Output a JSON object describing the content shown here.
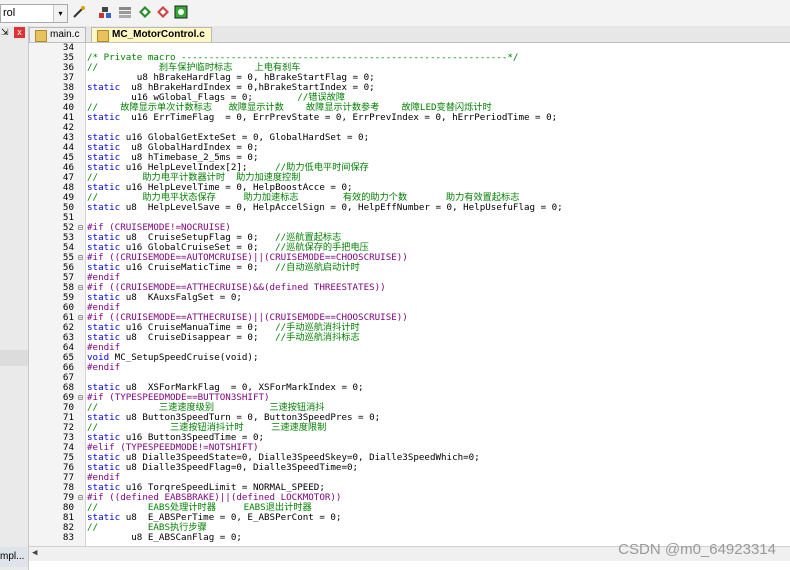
{
  "toolbar": {
    "combo_text": "rol",
    "combo_arrow": "▾",
    "icons": [
      "wand-icon",
      "build-icon",
      "rebuild-icon",
      "download-icon",
      "translate-icon"
    ]
  },
  "sidebar": {
    "close_label": "x",
    "bottom_label": "mpl..."
  },
  "tabs": [
    {
      "label": "main.c",
      "active": false
    },
    {
      "label": "MC_MotorControl.c",
      "active": true
    }
  ],
  "watermark": "CSDN @m0_64923314",
  "code": [
    {
      "n": "34",
      "t": "",
      "cls": "n"
    },
    {
      "n": "35",
      "t": "/* Private macro -----------------------------------------------------------*/",
      "cls": "c"
    },
    {
      "n": "36",
      "t": "//           刹车保护临时标志    上电有刹车",
      "cls": "c"
    },
    {
      "n": "37",
      "t": "         u8 hBrakeHardFlag = 0, hBrakeStartFlag = 0;",
      "cls": "n"
    },
    {
      "n": "38",
      "t": "static  u8 hBrakeHardIndex = 0,hBrakeStartIndex = 0;",
      "cls": "n"
    },
    {
      "n": "39",
      "t": "        u16 wGlobal_Flags = 0;        //错误故障",
      "cls": "n"
    },
    {
      "n": "40",
      "t": "//    故障显示单次计数标志   故障显示计数    故障显示计数参考    故障LED变替闪烁计时",
      "cls": "c"
    },
    {
      "n": "41",
      "t": "static  u16 ErrTimeFlag  = 0, ErrPrevState = 0, ErrPrevIndex = 0, hErrPeriodTime = 0;",
      "cls": "n"
    },
    {
      "n": "42",
      "t": "",
      "cls": "n"
    },
    {
      "n": "43",
      "t": "static u16 GlobalGetExteSet = 0, GlobalHardSet = 0;",
      "cls": "n"
    },
    {
      "n": "44",
      "t": "static  u8 GlobalHardIndex = 0;",
      "cls": "n"
    },
    {
      "n": "45",
      "t": "static  u8 hTimebase_2_5ms = 0;",
      "cls": "n"
    },
    {
      "n": "46",
      "t": "static u16 HelpLevelIndex[2];     //助力低电平时间保存",
      "cls": "n"
    },
    {
      "n": "47",
      "t": "//        助力电平计数器计时  助力加速度控制",
      "cls": "c"
    },
    {
      "n": "48",
      "t": "static u16 HelpLevelTime = 0, HelpBoostAcce = 0;",
      "cls": "n"
    },
    {
      "n": "49",
      "t": "//        助力电平状态保存     助力加速标志        有效的助力个数       助力有效置起标志",
      "cls": "c"
    },
    {
      "n": "50",
      "t": "static u8  HelpLevelSave = 0, HelpAccelSign = 0, HelpEffNumber = 0, HelpUsefuFlag = 0;",
      "cls": "n"
    },
    {
      "n": "51",
      "t": "",
      "cls": "n"
    },
    {
      "n": "52",
      "t": "#if (CRUISEMODE!=NOCRUISE)",
      "cls": "p",
      "f": "⊟"
    },
    {
      "n": "53",
      "t": "static u8  CruiseSetupFlag = 0;   //巡航置起标志",
      "cls": "n"
    },
    {
      "n": "54",
      "t": "static u16 GlobalCruiseSet = 0;   //巡航保存的手把电压",
      "cls": "n"
    },
    {
      "n": "55",
      "t": "#if ((CRUISEMODE==AUTOMCRUISE)||(CRUISEMODE==CHOOSCRUISE))",
      "cls": "p",
      "f": "⊟"
    },
    {
      "n": "56",
      "t": "static u16 CruiseMaticTime = 0;   //自动巡航启动计时",
      "cls": "n"
    },
    {
      "n": "57",
      "t": "#endif",
      "cls": "p"
    },
    {
      "n": "58",
      "t": "#if ((CRUISEMODE==ATTHECRUISE)&&(defined THREESTATES))",
      "cls": "p",
      "f": "⊟"
    },
    {
      "n": "59",
      "t": "static u8  KAuxsFalgSet = 0;",
      "cls": "n"
    },
    {
      "n": "60",
      "t": "#endif",
      "cls": "p"
    },
    {
      "n": "61",
      "t": "#if ((CRUISEMODE==ATTHECRUISE)||(CRUISEMODE==CHOOSCRUISE))",
      "cls": "p",
      "f": "⊟"
    },
    {
      "n": "62",
      "t": "static u16 CruiseManuaTime = 0;   //手动巡航消抖计时",
      "cls": "n"
    },
    {
      "n": "63",
      "t": "static u8  CruiseDisappear = 0;   //手动巡航消抖标志",
      "cls": "n"
    },
    {
      "n": "64",
      "t": "#endif",
      "cls": "p"
    },
    {
      "n": "65",
      "t": "void MC_SetupSpeedCruise(void);",
      "cls": "n"
    },
    {
      "n": "66",
      "t": "#endif",
      "cls": "p"
    },
    {
      "n": "67",
      "t": "",
      "cls": "n"
    },
    {
      "n": "68",
      "t": "static u8  XSForMarkFlag  = 0, XSForMarkIndex = 0;",
      "cls": "n"
    },
    {
      "n": "69",
      "t": "#if (TYPESPEEDMODE==BUTTON3SHIFT)",
      "cls": "p",
      "f": "⊟"
    },
    {
      "n": "70",
      "t": "//           三速速度级别          三速按钮消抖",
      "cls": "c"
    },
    {
      "n": "71",
      "t": "static u8 Button3SpeedTurn = 0, Button3SpeedPres = 0;",
      "cls": "n"
    },
    {
      "n": "72",
      "t": "//             三速按钮消抖计时     三速速度限制",
      "cls": "c"
    },
    {
      "n": "73",
      "t": "static u16 Button3SpeedTime = 0;",
      "cls": "n"
    },
    {
      "n": "74",
      "t": "#elif (TYPESPEEDMODE!=NOTSHIFT)",
      "cls": "p"
    },
    {
      "n": "75",
      "t": "static u8 Dialle3SpeedState=0, Dialle3SpeedSkey=0, Dialle3SpeedWhich=0;",
      "cls": "n"
    },
    {
      "n": "76",
      "t": "static u8 Dialle3SpeedFlag=0, Dialle3SpeedTime=0;",
      "cls": "n"
    },
    {
      "n": "77",
      "t": "#endif",
      "cls": "p"
    },
    {
      "n": "78",
      "t": "static u16 TorqreSpeedLimit = NORMAL_SPEED;",
      "cls": "n"
    },
    {
      "n": "79",
      "t": "#if ((defined EABSBRAKE)||(defined LOCKMOTOR))",
      "cls": "p",
      "f": "⊟"
    },
    {
      "n": "80",
      "t": "//         EABS处理计时器     EABS退出计时器",
      "cls": "c"
    },
    {
      "n": "81",
      "t": "static u8  E_ABSPerTime = 0, E_ABSPerCont = 0;",
      "cls": "n"
    },
    {
      "n": "82",
      "t": "//         EABS执行步骤",
      "cls": "c"
    },
    {
      "n": "83",
      "t": "        u8 E_ABSCanFlag = 0;",
      "cls": "n"
    }
  ]
}
